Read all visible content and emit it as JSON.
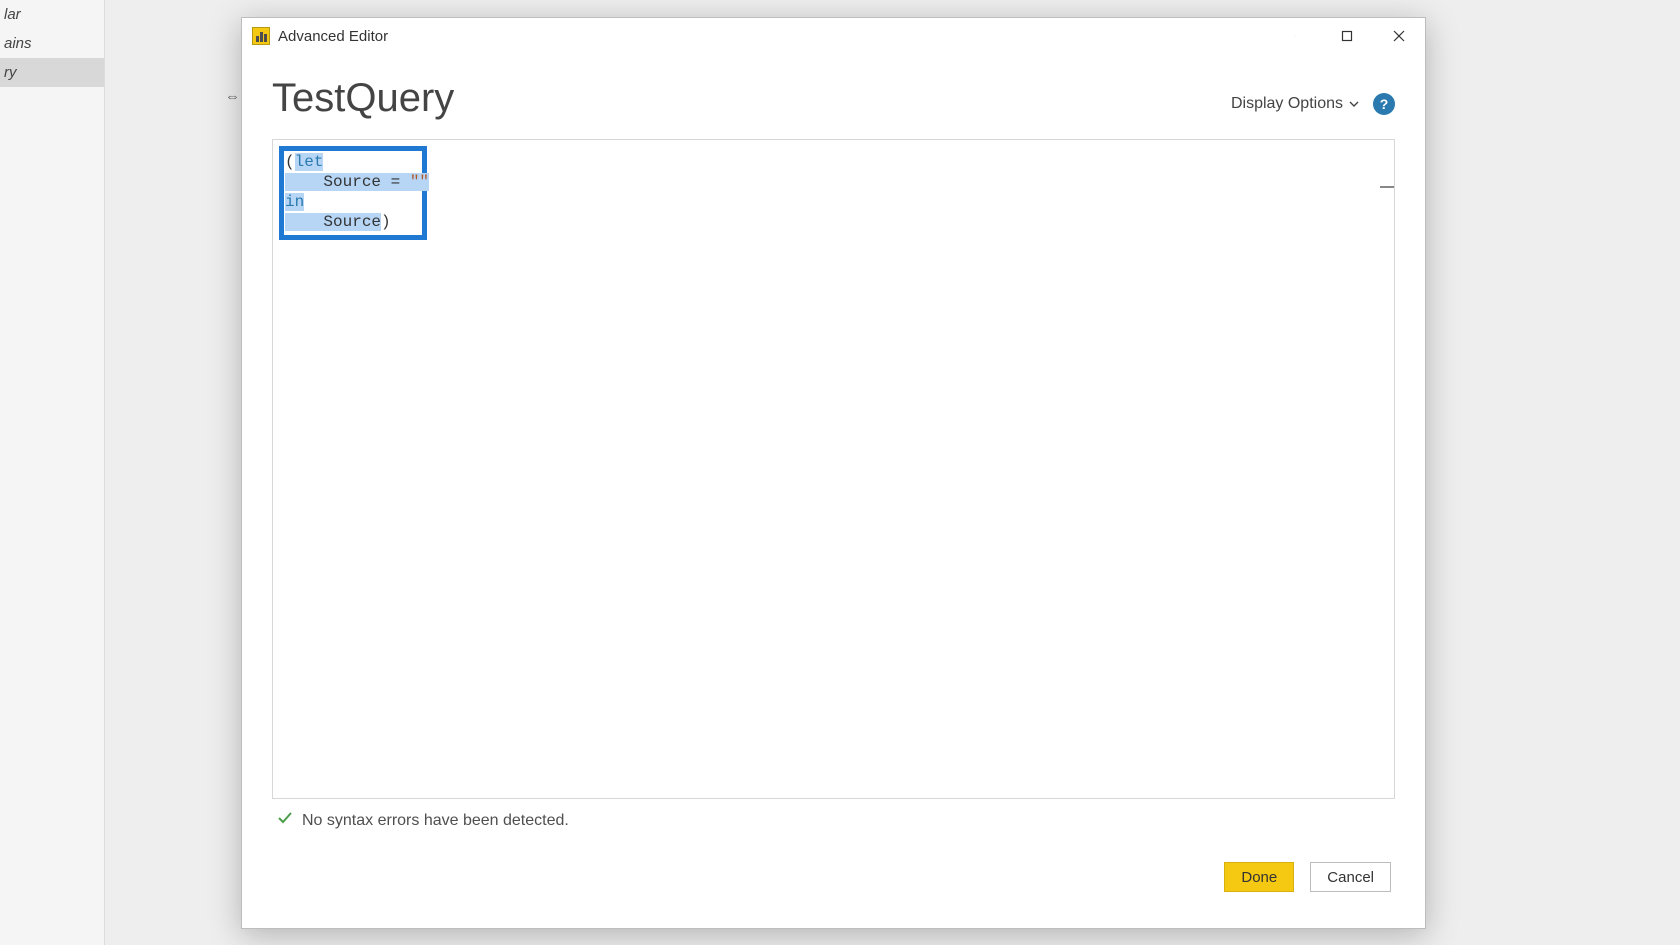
{
  "sidebar": {
    "items": [
      {
        "label": "lar"
      },
      {
        "label": "ains"
      },
      {
        "label": "ry",
        "selected": true
      }
    ]
  },
  "dialog": {
    "title": "Advanced Editor",
    "query_name": "TestQuery",
    "display_options_label": "Display Options",
    "help_glyph": "?",
    "code": {
      "paren_open": "(",
      "kw_let": "let",
      "line2_indent": "    ",
      "line2_ident": "Source = ",
      "line2_str": "\"\"",
      "kw_in": "in",
      "line4_indent": "    ",
      "line4_ident": "Source",
      "paren_close": ")"
    },
    "status_text": "No syntax errors have been detected.",
    "done_label": "Done",
    "cancel_label": "Cancel"
  },
  "decor": {
    "resize_glyph": "⇔"
  }
}
